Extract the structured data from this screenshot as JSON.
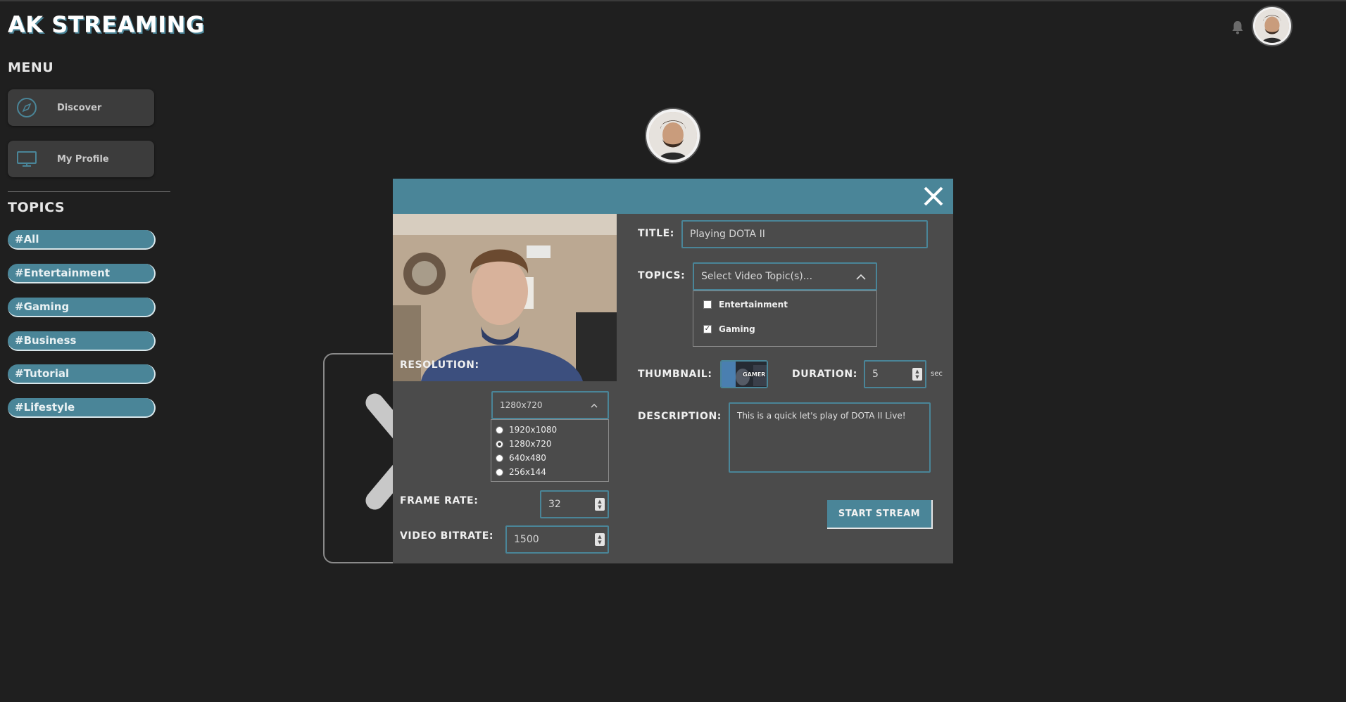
{
  "app": {
    "title": "AK STREAMING"
  },
  "header": {
    "bell_icon": "bell-icon",
    "avatar_icon": "user-avatar"
  },
  "sidebar": {
    "menu_title": "MENU",
    "menu_items": [
      {
        "label": "Discover",
        "icon": "compass-icon"
      },
      {
        "label": "My Profile",
        "icon": "monitor-icon"
      }
    ],
    "topics_title": "TOPICS",
    "topics": [
      "#All",
      "#Entertainment",
      "#Gaming",
      "#Business",
      "#Tutorial",
      "#Lifestyle"
    ]
  },
  "modal": {
    "close_icon": "close-icon",
    "resolution": {
      "label": "RESOLUTION:",
      "selected": "1280x720",
      "options": [
        "1920x1080",
        "1280x720",
        "640x480",
        "256x144"
      ],
      "selected_index": 1
    },
    "frame_rate": {
      "label": "FRAME RATE:",
      "value": "32"
    },
    "video_bitrate": {
      "label": "VIDEO BITRATE:",
      "value": "1500"
    },
    "title": {
      "label": "TITLE:",
      "value": "Playing DOTA II"
    },
    "topics": {
      "label": "TOPICS:",
      "placeholder": "Select Video Topic(s)...",
      "options": [
        {
          "label": "Entertainment",
          "checked": false
        },
        {
          "label": "Gaming",
          "checked": true
        }
      ]
    },
    "thumbnail": {
      "label": "THUMBNAIL:",
      "text": "GAMER"
    },
    "duration": {
      "label": "DURATION:",
      "value": "5",
      "unit": "sec"
    },
    "description": {
      "label": "DESCRIPTION:",
      "value": "This is a quick let's play of DOTA II Live!"
    },
    "start_button": "START STREAM"
  },
  "colors": {
    "accent": "#4a8598",
    "background": "#1f1f1f",
    "modal": "#4b4b4b"
  }
}
